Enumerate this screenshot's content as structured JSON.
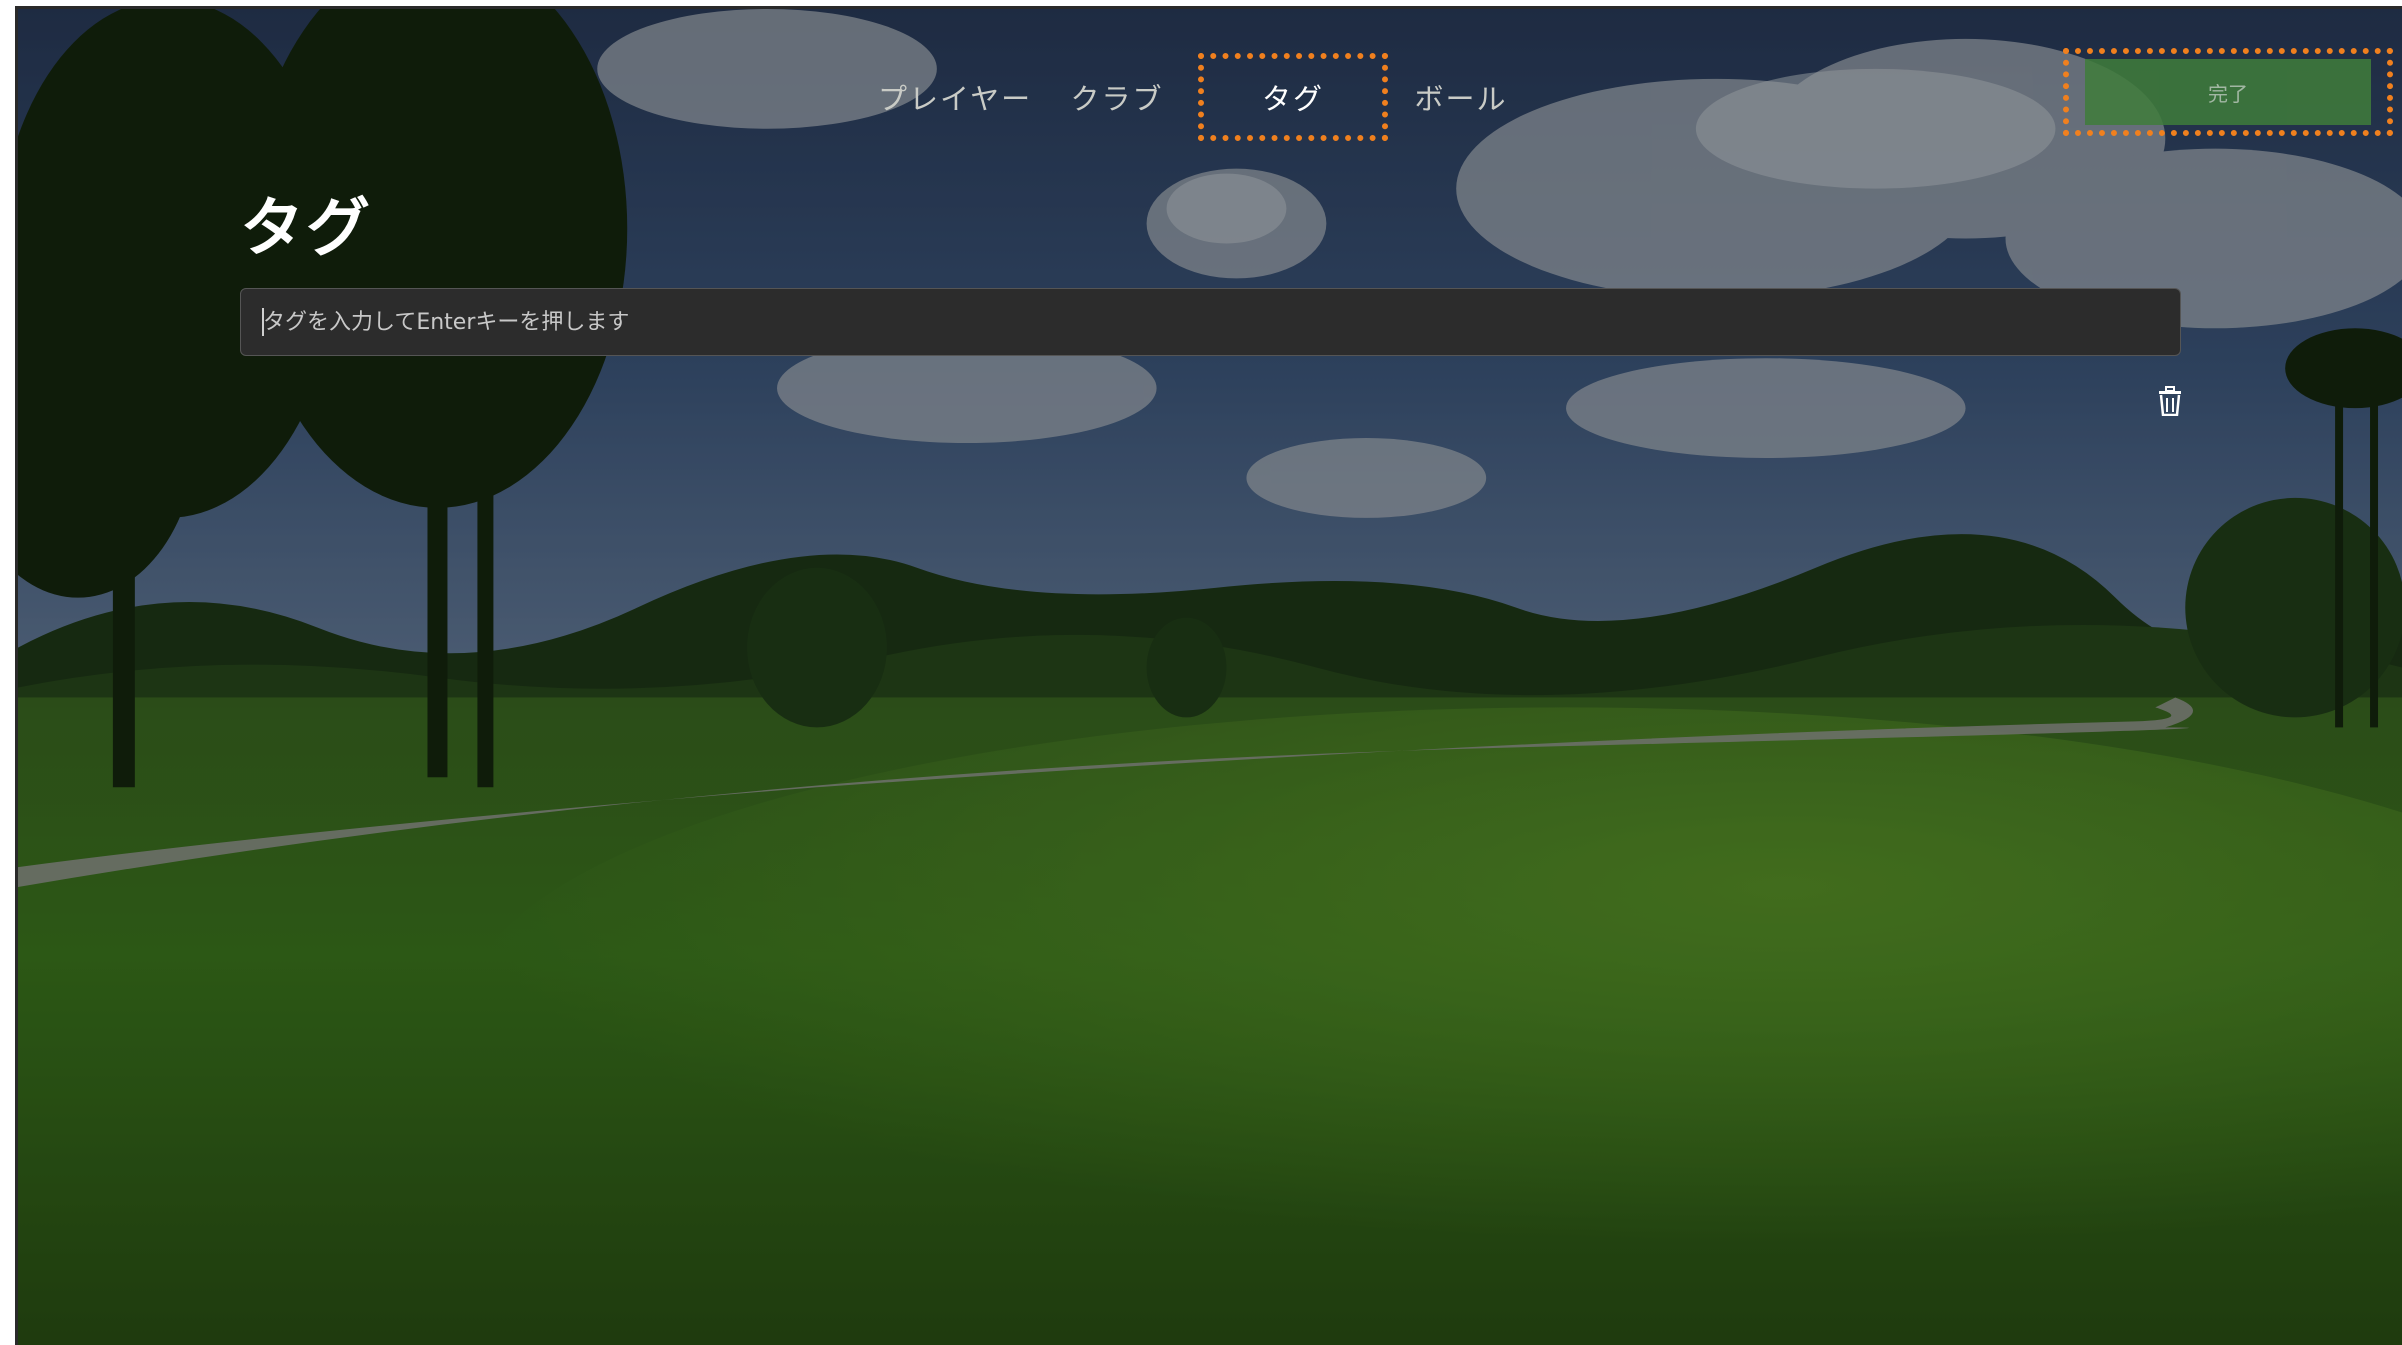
{
  "nav": {
    "tabs": [
      {
        "id": "player",
        "label": "プレイヤー"
      },
      {
        "id": "club",
        "label": "クラブ"
      },
      {
        "id": "tag",
        "label": "タグ",
        "active": true
      },
      {
        "id": "ball",
        "label": "ボール"
      }
    ],
    "done_label": "完了"
  },
  "main": {
    "title": "タグ",
    "input": {
      "placeholder": "タグを入力してEnterキーを押します",
      "value": ""
    },
    "delete_icon": "trash-icon"
  },
  "colors": {
    "highlight": "#f0801e",
    "done_button": "#3f7d3b",
    "input_bg": "#2c2c2c"
  }
}
